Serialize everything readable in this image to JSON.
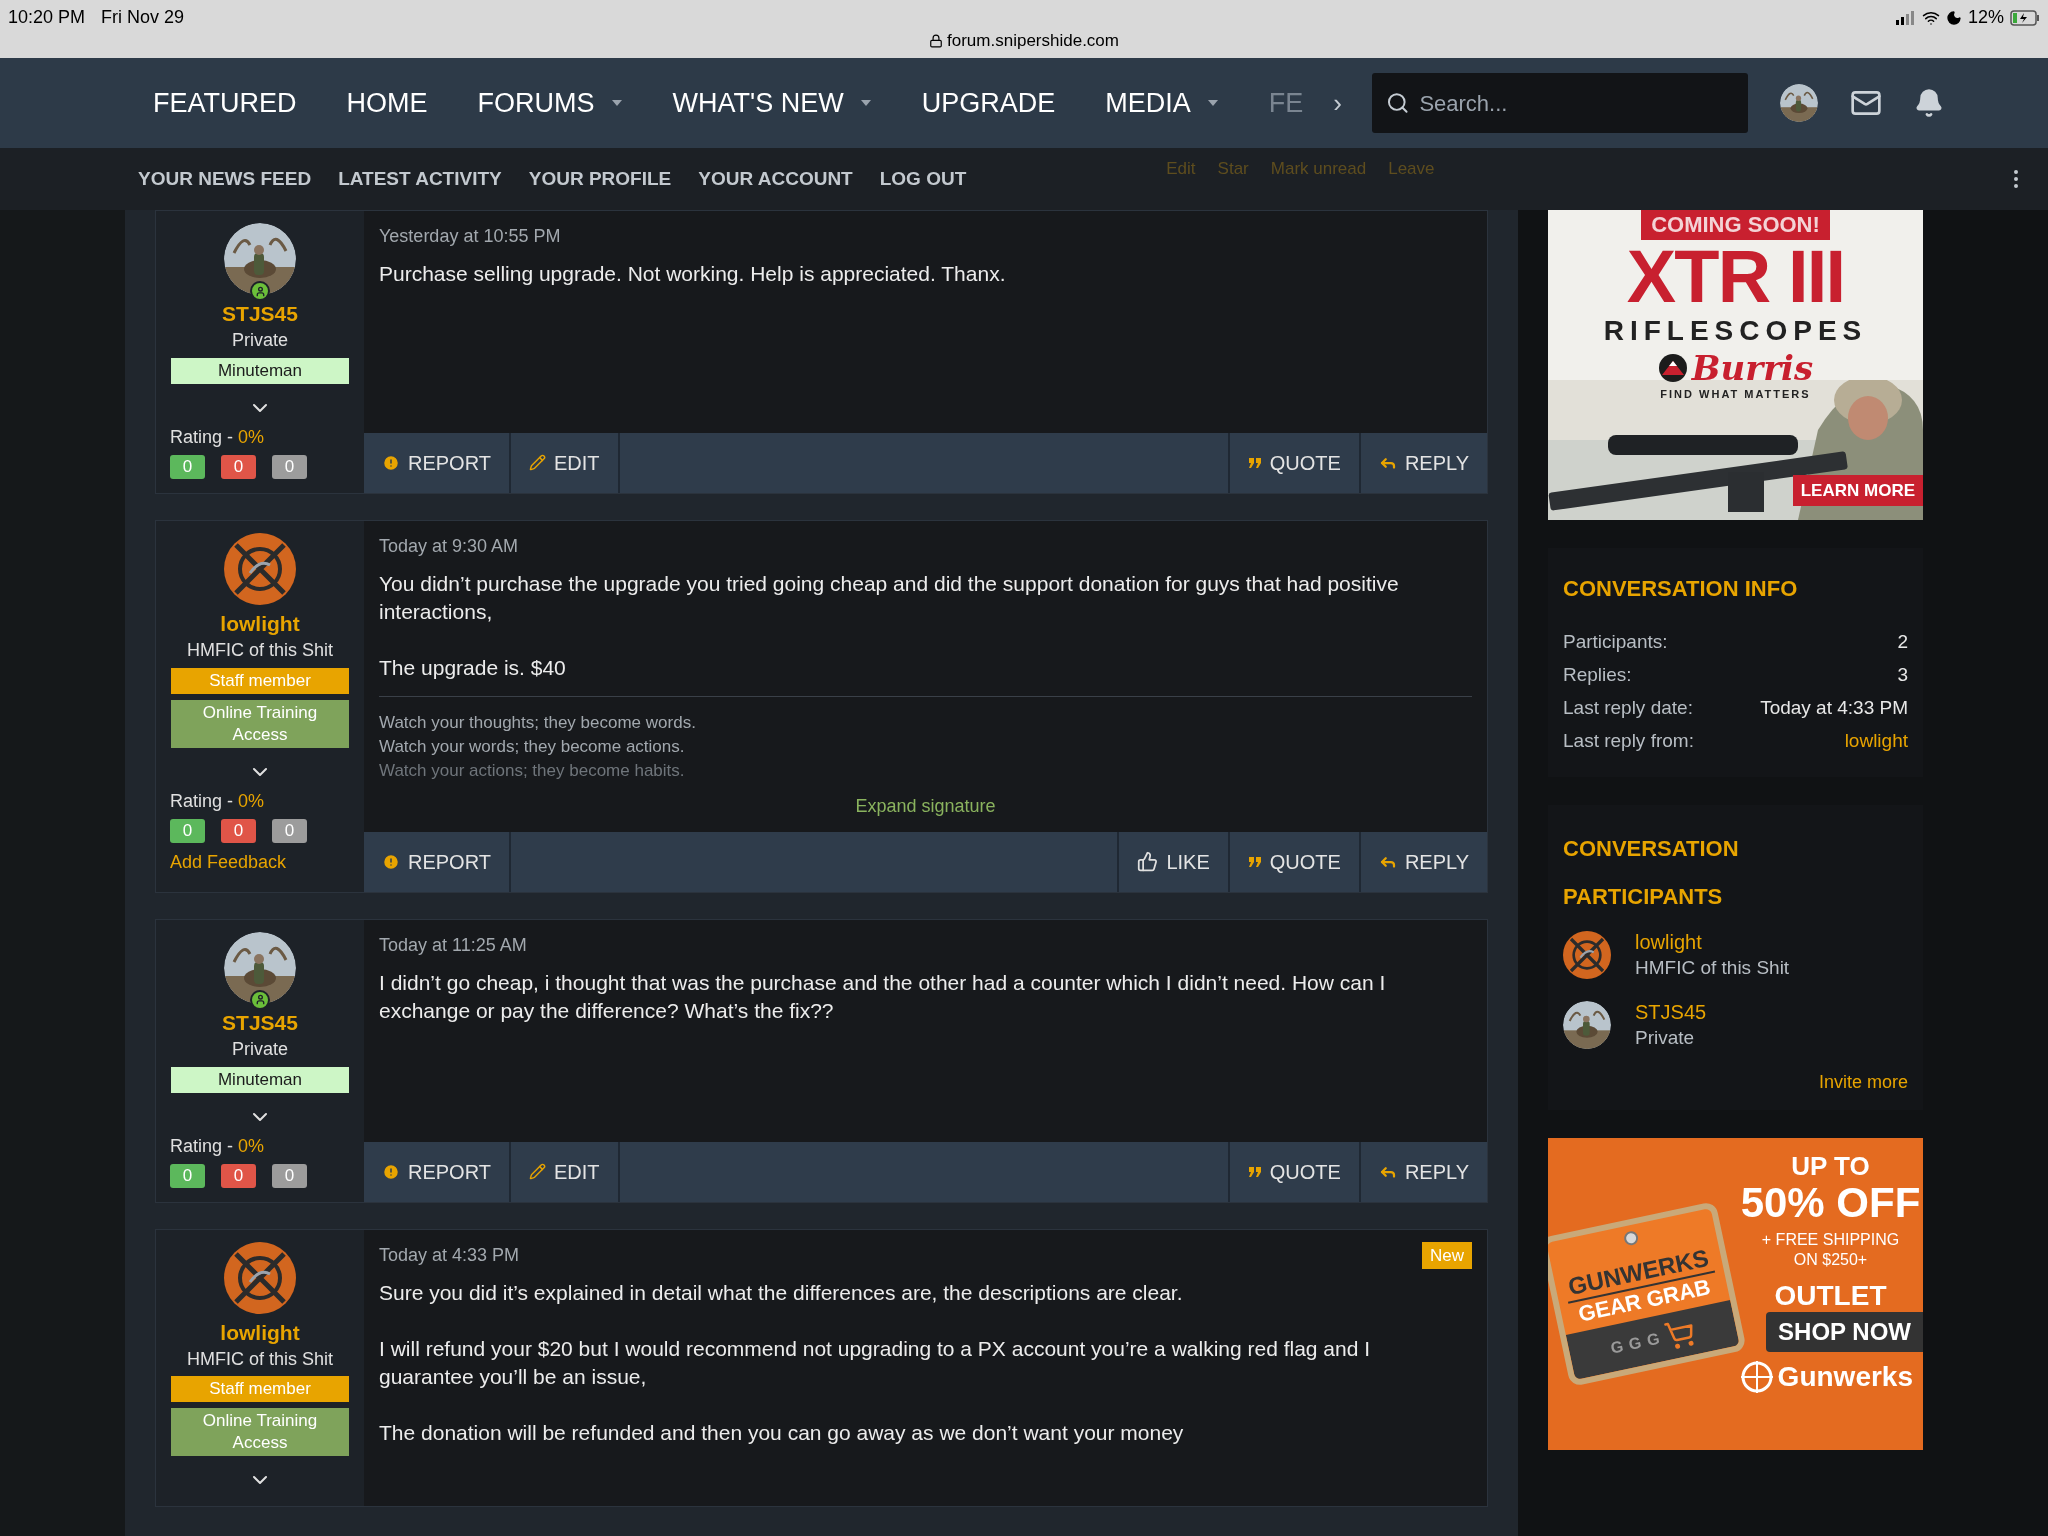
{
  "status_bar": {
    "time": "10:20 PM",
    "date": "Fri Nov 29",
    "url": "forum.snipershide.com",
    "battery": "12%"
  },
  "nav": {
    "items": [
      {
        "label": "FEATURED",
        "dropdown": false
      },
      {
        "label": "HOME",
        "dropdown": false
      },
      {
        "label": "FORUMS",
        "dropdown": true
      },
      {
        "label": "WHAT'S NEW",
        "dropdown": true
      },
      {
        "label": "UPGRADE",
        "dropdown": false
      },
      {
        "label": "MEDIA",
        "dropdown": true
      },
      {
        "label": "FE",
        "dropdown": false
      }
    ],
    "more": "›",
    "search": {
      "placeholder": "Search..."
    }
  },
  "subnav": {
    "links": [
      "YOUR NEWS FEED",
      "LATEST ACTIVITY",
      "YOUR PROFILE",
      "YOUR ACCOUNT",
      "LOG OUT"
    ],
    "thread_actions": [
      "Edit",
      "Star",
      "Mark unread",
      "Leave"
    ]
  },
  "posts": [
    {
      "user": {
        "name": "STJS45",
        "title": "Private",
        "online": true,
        "banners": [
          {
            "label": "Minuteman",
            "kind": "minuteman"
          }
        ],
        "rating": {
          "label": "Rating - ",
          "value": "0%",
          "feedback": [
            "0",
            "0",
            "0"
          ]
        }
      },
      "time": "Yesterday at 10:55 PM",
      "is_new": false,
      "paragraphs": [
        "Purchase selling upgrade. Not working. Help is appreciated. Thanx."
      ],
      "actions_left": [
        {
          "kind": "report",
          "label": "REPORT"
        },
        {
          "kind": "edit",
          "label": "EDIT"
        }
      ],
      "actions_right": [
        {
          "kind": "quote",
          "label": "QUOTE"
        },
        {
          "kind": "reply",
          "label": "REPLY"
        }
      ]
    },
    {
      "user": {
        "name": "lowlight",
        "title": "HMFIC of this Shit",
        "avatar": {
          "kind": "logo"
        },
        "online": false,
        "banners": [
          {
            "label": "Staff member",
            "kind": "staff"
          },
          {
            "label": "Online Training Access",
            "kind": "training"
          }
        ],
        "rating": {
          "label": "Rating - ",
          "value": "0%",
          "feedback": [
            "0",
            "0",
            "0"
          ]
        },
        "add_feedback": "Add Feedback"
      },
      "time": "Today at 9:30 AM",
      "is_new": false,
      "paragraphs": [
        "You didn’t purchase the upgrade you tried going cheap and did the support donation for guys that had positive interactions,",
        "The upgrade is. $40"
      ],
      "signature": [
        "Watch your thoughts; they become words.",
        "Watch your words; they become actions.",
        "Watch your actions; they become habits."
      ],
      "expand": "Expand signature",
      "actions_left": [
        {
          "kind": "report",
          "label": "REPORT"
        }
      ],
      "actions_right": [
        {
          "kind": "like",
          "label": "LIKE"
        },
        {
          "kind": "quote",
          "label": "QUOTE"
        },
        {
          "kind": "reply",
          "label": "REPLY"
        }
      ]
    },
    {
      "user": {
        "name": "STJS45",
        "title": "Private",
        "online": true,
        "banners": [
          {
            "label": "Minuteman",
            "kind": "minuteman"
          }
        ],
        "rating": {
          "label": "Rating - ",
          "value": "0%",
          "feedback": [
            "0",
            "0",
            "0"
          ]
        }
      },
      "time": "Today at 11:25 AM",
      "is_new": false,
      "paragraphs": [
        "I didn’t go cheap, i thought that was the purchase and the other had a counter which I didn’t need. How can I exchange or pay the difference? What’s the fix??"
      ],
      "actions_left": [
        {
          "kind": "report",
          "label": "REPORT"
        },
        {
          "kind": "edit",
          "label": "EDIT"
        }
      ],
      "actions_right": [
        {
          "kind": "quote",
          "label": "QUOTE"
        },
        {
          "kind": "reply",
          "label": "REPLY"
        }
      ]
    },
    {
      "user": {
        "name": "lowlight",
        "title": "HMFIC of this Shit",
        "avatar": {
          "kind": "logo"
        },
        "online": false,
        "banners": [
          {
            "label": "Staff member",
            "kind": "staff"
          },
          {
            "label": "Online Training Access",
            "kind": "training"
          }
        ]
      },
      "time": "Today at 4:33 PM",
      "is_new": true,
      "new_label": "New",
      "paragraphs": [
        "Sure you did it’s explained in detail what the differences are, the descriptions are clear.",
        "I will refund your $20 but I would recommend not upgrading to a PX account you’re a walking red flag and I guarantee you’ll be an issue,",
        "The donation will be refunded and then you can go away as we don’t want your money"
      ]
    }
  ],
  "ad_top": {
    "coming": "COMING SOON!",
    "product": "XTR III",
    "line": "RIFLESCOPES",
    "brand": "Burris",
    "tagline": "FIND WHAT MATTERS",
    "cta": "LEARN MORE"
  },
  "conversation_info": {
    "title": "CONVERSATION INFO",
    "rows": [
      {
        "label": "Participants:",
        "value": "2",
        "kind": "text"
      },
      {
        "label": "Replies:",
        "value": "3",
        "kind": "text"
      },
      {
        "label": "Last reply date:",
        "value": "Today at 4:33 PM",
        "kind": "text"
      },
      {
        "label": "Last reply from:",
        "value": "lowlight",
        "kind": "link"
      }
    ]
  },
  "participants": {
    "title": "CONVERSATION PARTICIPANTS",
    "people": [
      {
        "name": "lowlight",
        "title": "HMFIC of this Shit",
        "avatar": {
          "kind": "logo"
        }
      },
      {
        "name": "STJS45",
        "title": "Private"
      }
    ],
    "invite": "Invite more"
  },
  "ad_bottom": {
    "up_to": "UP TO",
    "discount": "50% OFF",
    "shipping": "+ FREE SHIPPING",
    "minimum": "ON $250+",
    "brand": "GUNWERKS",
    "event": "GEAR GRAB",
    "letters": [
      "G",
      "G",
      "G"
    ],
    "outlet": "OUTLET",
    "cta": "SHOP NOW",
    "logo": "Gunwerks"
  }
}
